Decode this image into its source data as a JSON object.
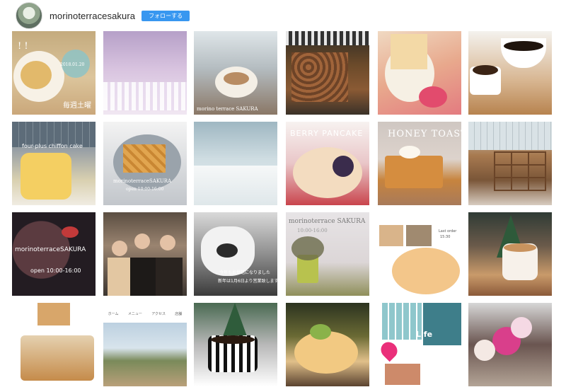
{
  "profile": {
    "username": "morinoterracesakura",
    "follow_label": "フォローする"
  },
  "posts": {
    "p11": {
      "top": "!  !",
      "date": "2018.01.20",
      "caption": "毎週土曜"
    },
    "p13": {
      "caption": "morino terrace SAKURA"
    },
    "p21": {
      "caption": "four-plus chiffon cake"
    },
    "p22": {
      "caption": "morinoterraceSAKURA",
      "hours": "open 10:00-16:00"
    },
    "p24": {
      "caption": "BERRY PANCAKE"
    },
    "p25": {
      "caption": "HONEY TOAST"
    },
    "p31": {
      "caption": "morinoterraceSAKURA",
      "hours": "open 10:00-16:00"
    },
    "p33": {
      "line1": "今年もお世話になりました",
      "line2": "新年は1月6日より営業致します"
    },
    "p34": {
      "caption": "morinoterrace SAKURA",
      "hours": "10:00-16:00"
    },
    "p35": {
      "sub": "Last order",
      "sub2": "15:30"
    },
    "p42": {
      "nav1": "ホーム",
      "nav2": "メニュー",
      "nav3": "アクセス",
      "nav4": "店舗"
    },
    "p45": {
      "caption": "Life"
    }
  },
  "colors": {
    "follow_button": "#3897f0",
    "text": "#262626"
  }
}
